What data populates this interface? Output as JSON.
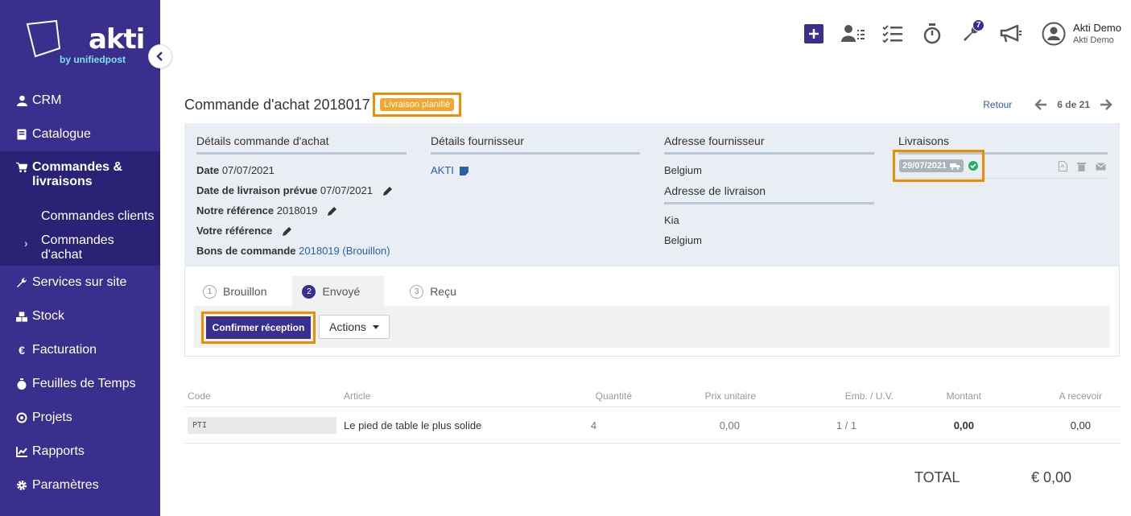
{
  "brand": {
    "name": "akti",
    "tagline": "by unifiedpost"
  },
  "sidebar": {
    "items": [
      {
        "label": "CRM",
        "icon": "user-icon"
      },
      {
        "label": "Catalogue",
        "icon": "book-icon"
      },
      {
        "label": "Commandes & livraisons",
        "icon": "cart-icon"
      },
      {
        "label": "Services sur site",
        "icon": "wrench-icon"
      },
      {
        "label": "Stock",
        "icon": "boxes-icon"
      },
      {
        "label": "Facturation",
        "icon": "euro-icon"
      },
      {
        "label": "Feuilles de Temps",
        "icon": "stopwatch-icon"
      },
      {
        "label": "Projets",
        "icon": "target-icon"
      },
      {
        "label": "Rapports",
        "icon": "chart-icon"
      },
      {
        "label": "Paramètres",
        "icon": "gear-icon"
      }
    ],
    "subitems": [
      {
        "label": "Commandes clients"
      },
      {
        "label": "Commandes d'achat"
      }
    ]
  },
  "topbar": {
    "badge_count": "7",
    "user_name": "Akti Demo",
    "user_company": "Akti Demo"
  },
  "page": {
    "title": "Commande d'achat 2018017",
    "status": "Livraison planifié",
    "back_label": "Retour",
    "pager": "6 de 21"
  },
  "details": {
    "order": {
      "title": "Détails commande d'achat",
      "date_label": "Date",
      "date": "07/07/2021",
      "delivery_label": "Date de livraison prévue",
      "delivery_date": "07/07/2021",
      "our_ref_label": "Notre référence",
      "our_ref": "2018019",
      "your_ref_label": "Votre référence",
      "po_label": "Bons de commande",
      "po_value": "2018019 (Brouillon)"
    },
    "supplier": {
      "title": "Détails fournisseur",
      "name": "AKTI"
    },
    "supplier_address": {
      "title": "Adresse fournisseur",
      "country": "Belgium"
    },
    "delivery_address": {
      "title": "Adresse de livraison",
      "name": "Kia",
      "country": "Belgium"
    },
    "deliveries": {
      "title": "Livraisons",
      "date": "29/07/2021"
    }
  },
  "steps": [
    {
      "num": "1",
      "label": "Brouillon"
    },
    {
      "num": "2",
      "label": "Envoyé"
    },
    {
      "num": "3",
      "label": "Reçu"
    }
  ],
  "actions": {
    "confirm": "Confirmer réception",
    "dropdown": "Actions"
  },
  "table": {
    "headers": [
      "Code",
      "Article",
      "Quantité",
      "Prix unitaire",
      "Emb. / U.V.",
      "Montant",
      "A recevoir"
    ],
    "rows": [
      {
        "code": "PTI",
        "article": "Le pied de table le plus solide",
        "qty": "4",
        "price": "0,00",
        "pack": "1 / 1",
        "amount": "0,00",
        "to_receive": "0,00"
      }
    ]
  },
  "total": {
    "label": "TOTAL",
    "value": "€ 0,00"
  },
  "colors": {
    "sidebar": "#3a2f8c",
    "sidebar_active": "#2b2276",
    "highlight": "#f08c00",
    "link": "#2b5fa6"
  }
}
